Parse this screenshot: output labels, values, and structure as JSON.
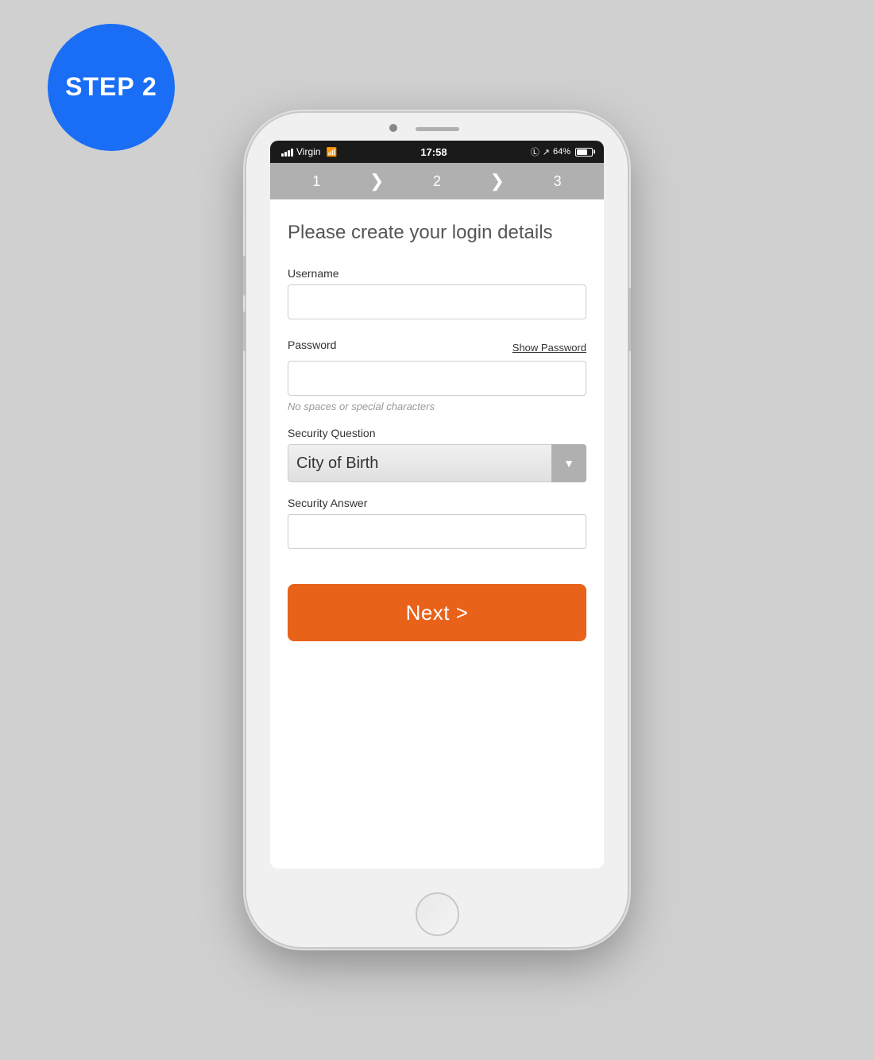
{
  "badge": {
    "line1": "STEP 2"
  },
  "status_bar": {
    "carrier": "Virgin",
    "time": "17:58",
    "battery_percent": "64%"
  },
  "steps": {
    "step1": "1",
    "step2": "2",
    "step3": "3"
  },
  "form": {
    "title": "Please create your login details",
    "username_label": "Username",
    "username_placeholder": "",
    "password_label": "Password",
    "password_placeholder": "",
    "show_password_label": "Show Password",
    "password_hint": "No spaces or special characters",
    "security_question_label": "Security Question",
    "security_question_value": "City of Birth",
    "security_answer_label": "Security Answer",
    "security_answer_placeholder": "",
    "next_button_label": "Next >"
  }
}
